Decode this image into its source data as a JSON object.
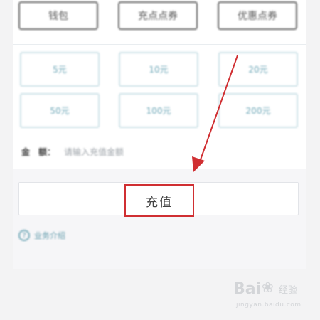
{
  "payment_methods": [
    {
      "label": "钱包"
    },
    {
      "label": "充点点券"
    },
    {
      "label": "优惠点券"
    }
  ],
  "amounts": [
    {
      "label": "5元"
    },
    {
      "label": "10元"
    },
    {
      "label": "20元"
    },
    {
      "label": "50元"
    },
    {
      "label": "100元"
    },
    {
      "label": "200元"
    }
  ],
  "custom_amount": {
    "label": "金　额：",
    "placeholder": "请输入充值金额"
  },
  "recharge_button": {
    "label": "充值"
  },
  "help": {
    "icon": "question-circle-icon",
    "label": "业务介绍"
  },
  "annotation": {
    "color": "#d02f32"
  },
  "watermark": {
    "brand": "Bai",
    "brand_suffix": "经验",
    "url": "jingyan.baidu.com"
  },
  "colors": {
    "accent": "#6fa8b8",
    "highlight": "#d02f32",
    "background": "#f3f3f4"
  }
}
